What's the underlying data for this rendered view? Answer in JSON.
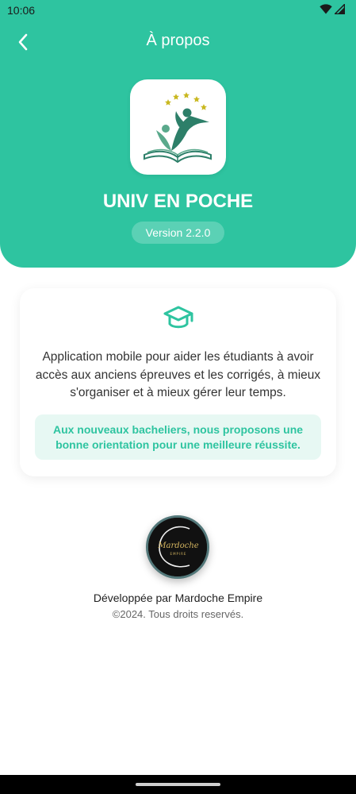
{
  "status_bar": {
    "time": "10:06",
    "icons": [
      "wifi-icon",
      "signal-icon"
    ]
  },
  "header": {
    "title": "À propos",
    "back_icon": "chevron-left-icon",
    "app_name": "UNIV EN POCHE",
    "version": "Version 2.2.0",
    "app_icon": "book-students-logo-icon"
  },
  "card": {
    "icon": "graduation-cap-icon",
    "description": "Application mobile pour aider les étudiants à avoir accès aux anciens épreuves et les corrigés, à mieux s'organiser et à mieux gérer leur temps.",
    "callout": "Aux nouveaux bacheliers, nous proposons une bonne orientation pour une meilleure réussite."
  },
  "developer": {
    "logo_text": "Mardoche",
    "logo_subtext": "EMPIRE",
    "credit": "Développée par Mardoche Empire",
    "copyright": "©2024. Tous droits reservés."
  },
  "colors": {
    "primary": "#2ec4a0",
    "callout_bg": "#e7f8f3",
    "text": "#333333",
    "muted": "#666666"
  }
}
